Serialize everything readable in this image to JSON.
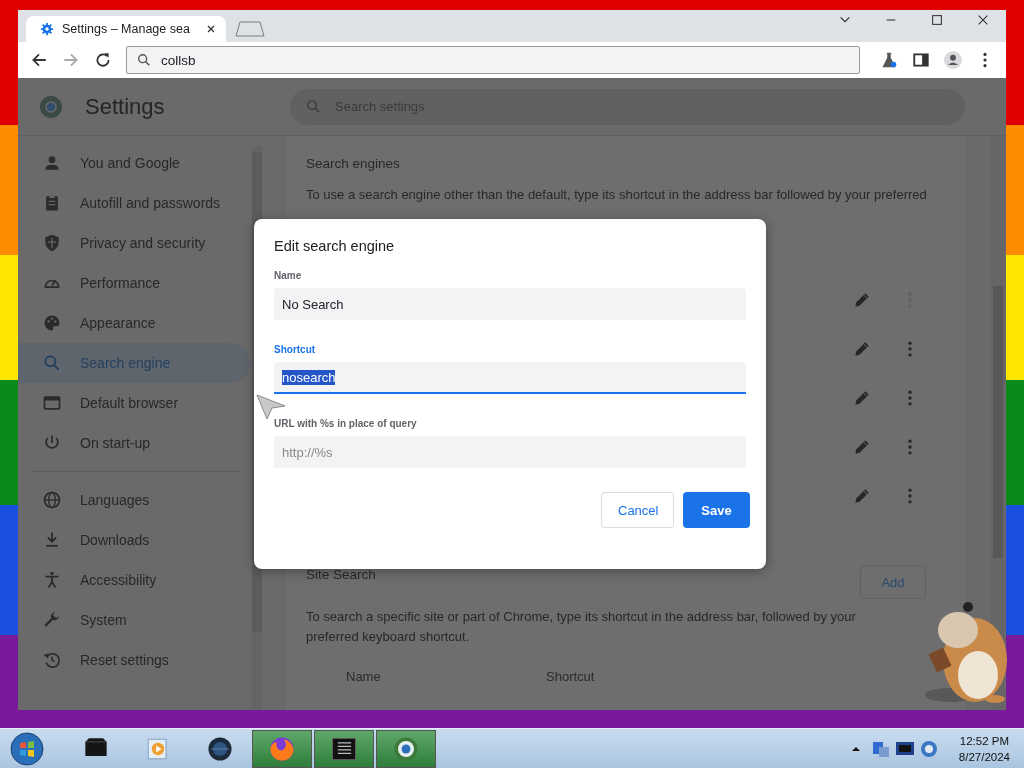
{
  "browser": {
    "tabs": [
      {
        "title": "Settings – Manage sea",
        "selected": true
      }
    ],
    "address": "collsb"
  },
  "settings": {
    "title": "Settings",
    "search": {
      "placeholder": "Search settings"
    },
    "sidebar": {
      "groups": [
        [
          {
            "label": "You and Google",
            "selected": false
          },
          {
            "label": "Autofill and passwords",
            "selected": false
          },
          {
            "label": "Privacy and security",
            "selected": false
          },
          {
            "label": "Performance",
            "selected": false
          },
          {
            "label": "Appearance",
            "selected": false
          },
          {
            "label": "Search engine",
            "selected": true
          },
          {
            "label": "Default browser",
            "selected": false
          },
          {
            "label": "On start-up",
            "selected": false
          }
        ],
        [
          {
            "label": "Languages",
            "selected": false
          },
          {
            "label": "Downloads",
            "selected": false
          },
          {
            "label": "Accessibility",
            "selected": false
          },
          {
            "label": "System",
            "selected": false
          },
          {
            "label": "Reset settings",
            "selected": false
          }
        ]
      ]
    },
    "search_engines": {
      "title": "Search engines",
      "description": "To use a search engine other than the default, type its shortcut in the address bar followed by your preferred",
      "rows": [
        {
          "menu_disabled": true
        },
        {
          "menu_disabled": false
        },
        {
          "menu_disabled": false
        },
        {
          "menu_disabled": false
        },
        {
          "menu_disabled": false
        }
      ]
    },
    "site_search": {
      "title": "Site Search",
      "add_button": "Add",
      "description": "To search a specific site or part of Chrome, type its shortcut in the address bar, followed by your preferred keyboard shortcut.",
      "columns": [
        "Name",
        "Shortcut"
      ]
    }
  },
  "dialog": {
    "title": "Edit search engine",
    "fields": [
      {
        "label": "Name",
        "value": "No Search",
        "focused": false,
        "text_selected": false
      },
      {
        "label": "Shortcut",
        "value": "nosearch",
        "focused": true,
        "text_selected": true
      },
      {
        "label": "URL with %s in place of query",
        "placeholder": "http://%s",
        "focused": false
      }
    ],
    "buttons": [
      {
        "label": "Cancel",
        "kind": "secondary"
      },
      {
        "label": "Save",
        "kind": "primary"
      }
    ]
  },
  "taskbar": {
    "apps": [
      {
        "running": false
      },
      {
        "running": false
      },
      {
        "running": false
      },
      {
        "running": true
      },
      {
        "running": true
      },
      {
        "running": true
      }
    ],
    "clock": {
      "time": "12:52 PM",
      "date": "8/27/2024"
    }
  }
}
